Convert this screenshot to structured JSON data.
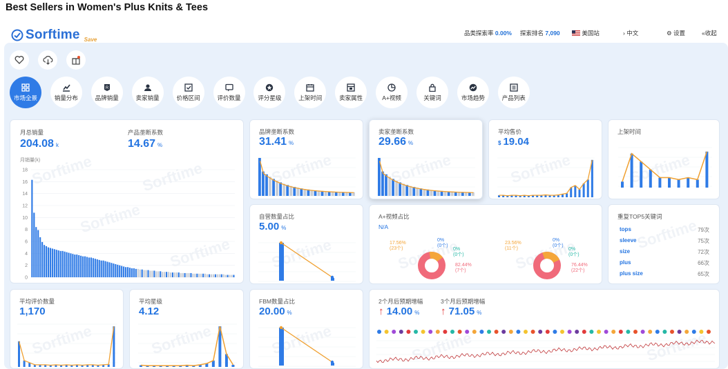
{
  "page_title": "Best Sellers in Women's Plus Knits & Tees",
  "brand": {
    "name": "Sorftime",
    "save": "Save"
  },
  "topbar": {
    "search_rate_label": "品类探索率",
    "search_rate": "0.00%",
    "rank_label": "探索排名",
    "rank": "7,090",
    "site": "美国站",
    "lang": "中文",
    "settings": "设置",
    "collapse": "收起"
  },
  "nav": [
    {
      "label": "市场全景",
      "icon": "grid-icon"
    },
    {
      "label": "销量分布",
      "icon": "bar-chart-icon"
    },
    {
      "label": "品牌销量",
      "icon": "brand-icon"
    },
    {
      "label": "卖家销量",
      "icon": "seller-icon"
    },
    {
      "label": "价格区间",
      "icon": "price-icon"
    },
    {
      "label": "评价数量",
      "icon": "review-icon"
    },
    {
      "label": "评分星级",
      "icon": "star-icon"
    },
    {
      "label": "上架时间",
      "icon": "calendar-icon"
    },
    {
      "label": "卖家属性",
      "icon": "store-icon"
    },
    {
      "label": "A+视频",
      "icon": "video-icon"
    },
    {
      "label": "关键词",
      "icon": "lock-icon"
    },
    {
      "label": "市场趋势",
      "icon": "trend-icon"
    },
    {
      "label": "产品列表",
      "icon": "list-icon"
    }
  ],
  "cards": {
    "monthly_sales": {
      "label": "月总销量",
      "value": "204.08",
      "unit": "k",
      "axis_label": "月销量(k)"
    },
    "product_monopoly": {
      "label": "产品垄断系数",
      "value": "14.67",
      "unit": "%"
    },
    "brand_monopoly": {
      "label": "品牌垄断系数",
      "value": "31.41",
      "unit": "%"
    },
    "seller_monopoly": {
      "label": "卖家垄断系数",
      "value": "29.66",
      "unit": "%"
    },
    "avg_price": {
      "label": "平均售价",
      "value": "19.04",
      "currency": "$"
    },
    "listing_time": {
      "label": "上架时间"
    },
    "self_operated": {
      "label": "自营数量占比",
      "value": "5.00",
      "unit": "%"
    },
    "aplus_video": {
      "label": "A+视频占比",
      "value": "N/A"
    },
    "top_keywords": {
      "label": "重复TOP5关键词"
    },
    "avg_reviews": {
      "label": "平均评价数量",
      "value": "1,170"
    },
    "avg_rating": {
      "label": "平均星级",
      "value": "4.12"
    },
    "fba_share": {
      "label": "FBM数量占比",
      "value": "20.00",
      "unit": "%"
    },
    "growth": {
      "label2": "2个月后预期增幅",
      "value2": "14.00",
      "unit2": "%",
      "label3": "3个月后预期增幅",
      "value3": "71.05",
      "unit3": "%"
    }
  },
  "donut1": {
    "top_pct": "17.56%",
    "top_cnt": "(23个)",
    "mid1_pct": "0%",
    "mid1_cnt": "(0个)",
    "mid2_pct": "0%",
    "mid2_cnt": "(0个)",
    "bot_pct": "82.44%",
    "bot_cnt": "(7个)"
  },
  "donut2": {
    "top_pct": "23.56%",
    "top_cnt": "(11个)",
    "mid1_pct": "0%",
    "mid1_cnt": "(0个)",
    "mid2_pct": "0%",
    "mid2_cnt": "(0个)",
    "bot_pct": "76.44%",
    "bot_cnt": "(22个)"
  },
  "keywords": [
    {
      "word": "tops",
      "count": "79次"
    },
    {
      "word": "sleeve",
      "count": "75次"
    },
    {
      "word": "size",
      "count": "72次"
    },
    {
      "word": "plus",
      "count": "66次"
    },
    {
      "word": "plus size",
      "count": "65次"
    }
  ],
  "colors": {
    "accent": "#2f7be6",
    "bar": "#2f7be6",
    "line": "#f0a030",
    "red": "#e23b3b"
  },
  "chart_data": [
    {
      "type": "bar",
      "title": "月总销量",
      "ylabel": "月销量(k)",
      "ylim": [
        0,
        18
      ],
      "yticks": [
        0,
        2,
        4,
        6,
        8,
        10,
        12,
        14,
        16,
        18
      ],
      "values": [
        16.3,
        10.8,
        8.4,
        7.9,
        6.7,
        5.9,
        5.4,
        5.2,
        5.0,
        4.9,
        4.8,
        4.7,
        4.6,
        4.5,
        4.4,
        4.4,
        4.3,
        4.2,
        4.1,
        4.0,
        3.9,
        3.8,
        3.8,
        3.7,
        3.6,
        3.5,
        3.5,
        3.4,
        3.3,
        3.3,
        3.2,
        3.1,
        3.0,
        2.9,
        2.8,
        2.8,
        2.7,
        2.6,
        2.5,
        2.4,
        2.3,
        2.2,
        2.1,
        2.0,
        1.9,
        1.8,
        1.7,
        1.7,
        1.6,
        1.5,
        1.5,
        1.4,
        1.4,
        1.3,
        1.3,
        1.2,
        1.2,
        1.2,
        1.1,
        1.1,
        1.1,
        1.0,
        1.0,
        1.0,
        0.9,
        0.9,
        0.9,
        0.9,
        0.8,
        0.8,
        0.8,
        0.8,
        0.8,
        0.7,
        0.7,
        0.7,
        0.7,
        0.7,
        0.7,
        0.6,
        0.6,
        0.6,
        0.6,
        0.6,
        0.6,
        0.6,
        0.5,
        0.5,
        0.5,
        0.5,
        0.5,
        0.5,
        0.5,
        0.5,
        0.5,
        0.4,
        0.4,
        0.4,
        0.4,
        0.4
      ]
    }
  ]
}
